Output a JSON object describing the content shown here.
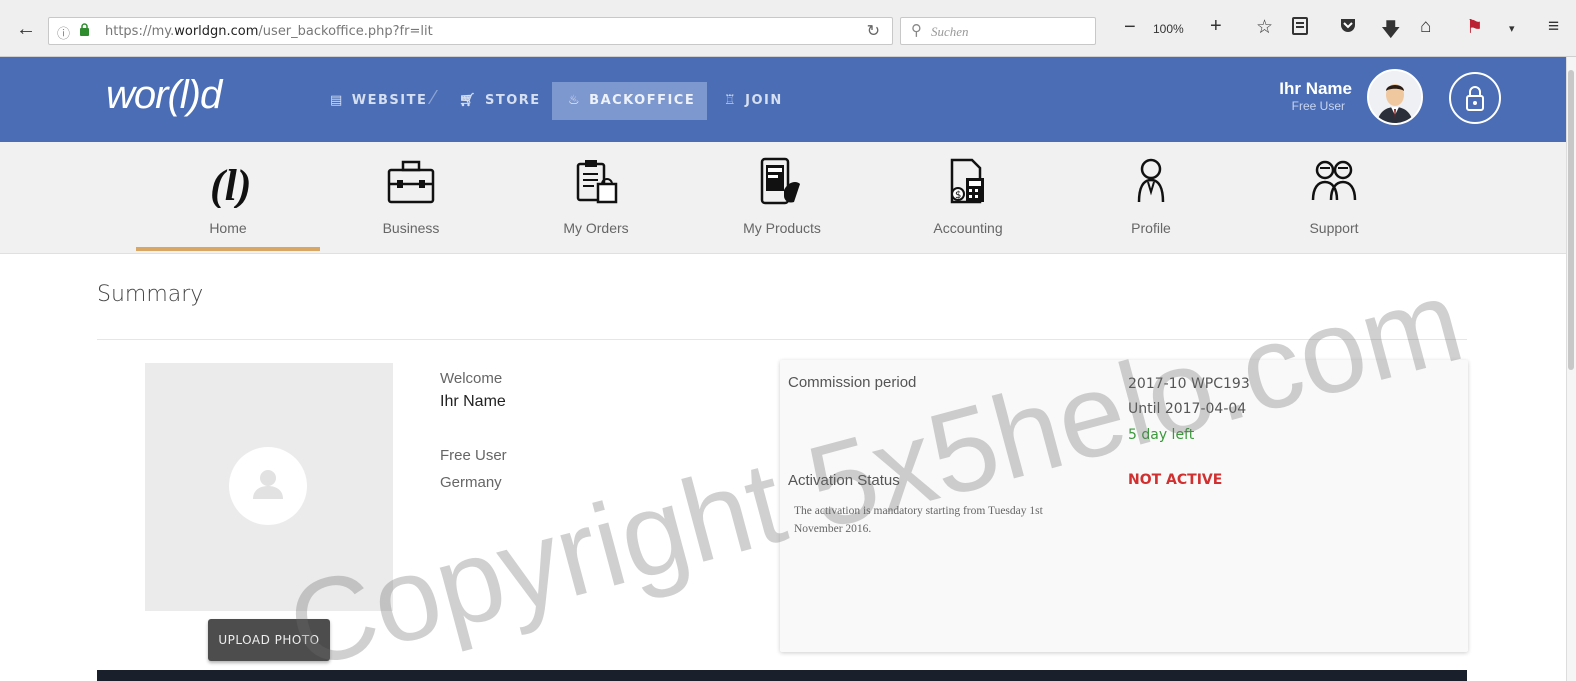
{
  "browser": {
    "back_glyph": "←",
    "url_prefix": "https://my.",
    "url_domain": "worldgn.com",
    "url_path": "/user_backoffice.php?fr=lit",
    "search_placeholder": "Suchen",
    "zoom_minus": "−",
    "zoom_level": "100%",
    "zoom_plus": "+",
    "toolbar_icons": [
      "bookmark-star-icon",
      "reading-list-icon",
      "pocket-icon",
      "download-icon",
      "home-icon",
      "flag-addon-icon",
      "overflow-icon",
      "hamburger-menu-icon"
    ]
  },
  "header": {
    "logo": "wor(l)d",
    "nav": {
      "website": "WEBSITE",
      "store": "STORE",
      "backoffice": "BACKOFFICE",
      "join": "JOIN"
    },
    "user_name": "Ihr Name",
    "user_role": "Free User",
    "accent": "#4a6db5"
  },
  "subnav": {
    "items": [
      {
        "label": "Home",
        "icon": "world-logo-icon"
      },
      {
        "label": "Business",
        "icon": "briefcase-icon"
      },
      {
        "label": "My Orders",
        "icon": "clipboard-bag-icon"
      },
      {
        "label": "My Products",
        "icon": "phone-hand-icon"
      },
      {
        "label": "Accounting",
        "icon": "document-calculator-icon"
      },
      {
        "label": "Profile",
        "icon": "person-icon"
      },
      {
        "label": "Support",
        "icon": "people-support-icon"
      }
    ],
    "active_index": 0,
    "active_color": "#d8a764"
  },
  "main": {
    "title": "Summary",
    "upload_label": "UPLOAD PHOTO",
    "welcome_label": "Welcome",
    "welcome_name": "Ihr Name",
    "user_type": "Free User",
    "country": "Germany"
  },
  "card": {
    "commission_label": "Commission period",
    "commission_code": "2017-10 WPC193",
    "commission_until": "Until 2017-04-04",
    "days_left": "5 day left",
    "activation_label": "Activation Status",
    "activation_status": "NOT ACTIVE",
    "activation_note": "The activation is mandatory starting from Tuesday 1st November 2016.",
    "ok_color": "#3a9a3a",
    "alert_color": "#d03030"
  },
  "watermark": "Copyright 5x5helo.com"
}
